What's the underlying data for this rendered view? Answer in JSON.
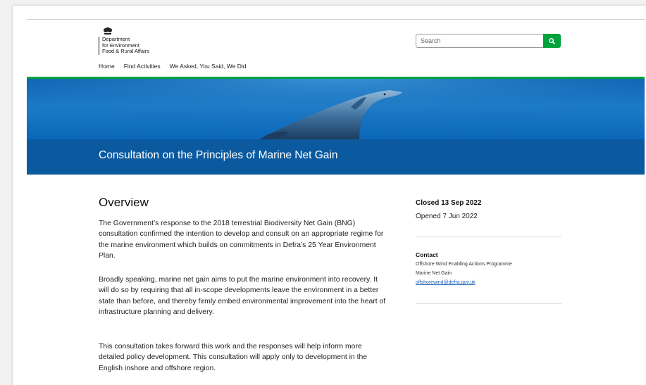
{
  "header": {
    "logo_lines": [
      "Department",
      "for Environment",
      "Food & Rural Affairs"
    ],
    "search_placeholder": "Search"
  },
  "nav": {
    "items": [
      "Home",
      "Find Activities",
      "We Asked, You Said, We Did"
    ]
  },
  "banner": {
    "title": "Consultation on the Principles of Marine Net Gain"
  },
  "overview": {
    "heading": "Overview",
    "paragraphs": [
      "The Government’s response to the 2018 terrestrial Biodiversity Net Gain (BNG) consultation confirmed the intention to develop and consult on an appropriate regime for the marine environment which builds on commitments in Defra’s 25 Year Environment Plan.",
      "Broadly speaking, marine net gain aims to put the marine environment into recovery. It will do so by requiring that all in-scope developments leave the environment in a better state than before, and thereby firmly embed environmental improvement into the heart of infrastructure planning and delivery.",
      "This consultation takes forward this work and the responses will help inform more detailed policy development. This consultation will apply only to development in the English inshore and offshore region."
    ]
  },
  "sidebar": {
    "closed": "Closed 13 Sep 2022",
    "opened": "Opened 7 Jun 2022",
    "contact_label": "Contact",
    "contact_org": "Offshore Wind Enabling Actions Programme",
    "contact_team": "Marine Net Gain",
    "contact_email": "offshorewind@defra.gov.uk"
  },
  "colors": {
    "accent_green": "#00a33b",
    "banner_blue": "#0b5aa0",
    "link_blue": "#1d5fb3"
  },
  "icons": {
    "search": "search-icon",
    "crest": "royal-crest-icon"
  }
}
